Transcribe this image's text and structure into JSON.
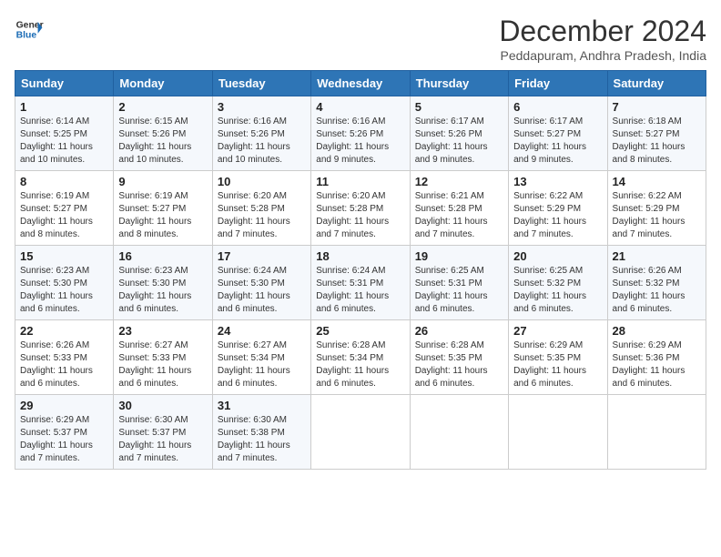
{
  "logo": {
    "line1": "General",
    "line2": "Blue"
  },
  "title": "December 2024",
  "subtitle": "Peddapuram, Andhra Pradesh, India",
  "days_of_week": [
    "Sunday",
    "Monday",
    "Tuesday",
    "Wednesday",
    "Thursday",
    "Friday",
    "Saturday"
  ],
  "weeks": [
    [
      {
        "day": "1",
        "info": "Sunrise: 6:14 AM\nSunset: 5:25 PM\nDaylight: 11 hours\nand 10 minutes."
      },
      {
        "day": "2",
        "info": "Sunrise: 6:15 AM\nSunset: 5:26 PM\nDaylight: 11 hours\nand 10 minutes."
      },
      {
        "day": "3",
        "info": "Sunrise: 6:16 AM\nSunset: 5:26 PM\nDaylight: 11 hours\nand 10 minutes."
      },
      {
        "day": "4",
        "info": "Sunrise: 6:16 AM\nSunset: 5:26 PM\nDaylight: 11 hours\nand 9 minutes."
      },
      {
        "day": "5",
        "info": "Sunrise: 6:17 AM\nSunset: 5:26 PM\nDaylight: 11 hours\nand 9 minutes."
      },
      {
        "day": "6",
        "info": "Sunrise: 6:17 AM\nSunset: 5:27 PM\nDaylight: 11 hours\nand 9 minutes."
      },
      {
        "day": "7",
        "info": "Sunrise: 6:18 AM\nSunset: 5:27 PM\nDaylight: 11 hours\nand 8 minutes."
      }
    ],
    [
      {
        "day": "8",
        "info": "Sunrise: 6:19 AM\nSunset: 5:27 PM\nDaylight: 11 hours\nand 8 minutes."
      },
      {
        "day": "9",
        "info": "Sunrise: 6:19 AM\nSunset: 5:27 PM\nDaylight: 11 hours\nand 8 minutes."
      },
      {
        "day": "10",
        "info": "Sunrise: 6:20 AM\nSunset: 5:28 PM\nDaylight: 11 hours\nand 7 minutes."
      },
      {
        "day": "11",
        "info": "Sunrise: 6:20 AM\nSunset: 5:28 PM\nDaylight: 11 hours\nand 7 minutes."
      },
      {
        "day": "12",
        "info": "Sunrise: 6:21 AM\nSunset: 5:28 PM\nDaylight: 11 hours\nand 7 minutes."
      },
      {
        "day": "13",
        "info": "Sunrise: 6:22 AM\nSunset: 5:29 PM\nDaylight: 11 hours\nand 7 minutes."
      },
      {
        "day": "14",
        "info": "Sunrise: 6:22 AM\nSunset: 5:29 PM\nDaylight: 11 hours\nand 7 minutes."
      }
    ],
    [
      {
        "day": "15",
        "info": "Sunrise: 6:23 AM\nSunset: 5:30 PM\nDaylight: 11 hours\nand 6 minutes."
      },
      {
        "day": "16",
        "info": "Sunrise: 6:23 AM\nSunset: 5:30 PM\nDaylight: 11 hours\nand 6 minutes."
      },
      {
        "day": "17",
        "info": "Sunrise: 6:24 AM\nSunset: 5:30 PM\nDaylight: 11 hours\nand 6 minutes."
      },
      {
        "day": "18",
        "info": "Sunrise: 6:24 AM\nSunset: 5:31 PM\nDaylight: 11 hours\nand 6 minutes."
      },
      {
        "day": "19",
        "info": "Sunrise: 6:25 AM\nSunset: 5:31 PM\nDaylight: 11 hours\nand 6 minutes."
      },
      {
        "day": "20",
        "info": "Sunrise: 6:25 AM\nSunset: 5:32 PM\nDaylight: 11 hours\nand 6 minutes."
      },
      {
        "day": "21",
        "info": "Sunrise: 6:26 AM\nSunset: 5:32 PM\nDaylight: 11 hours\nand 6 minutes."
      }
    ],
    [
      {
        "day": "22",
        "info": "Sunrise: 6:26 AM\nSunset: 5:33 PM\nDaylight: 11 hours\nand 6 minutes."
      },
      {
        "day": "23",
        "info": "Sunrise: 6:27 AM\nSunset: 5:33 PM\nDaylight: 11 hours\nand 6 minutes."
      },
      {
        "day": "24",
        "info": "Sunrise: 6:27 AM\nSunset: 5:34 PM\nDaylight: 11 hours\nand 6 minutes."
      },
      {
        "day": "25",
        "info": "Sunrise: 6:28 AM\nSunset: 5:34 PM\nDaylight: 11 hours\nand 6 minutes."
      },
      {
        "day": "26",
        "info": "Sunrise: 6:28 AM\nSunset: 5:35 PM\nDaylight: 11 hours\nand 6 minutes."
      },
      {
        "day": "27",
        "info": "Sunrise: 6:29 AM\nSunset: 5:35 PM\nDaylight: 11 hours\nand 6 minutes."
      },
      {
        "day": "28",
        "info": "Sunrise: 6:29 AM\nSunset: 5:36 PM\nDaylight: 11 hours\nand 6 minutes."
      }
    ],
    [
      {
        "day": "29",
        "info": "Sunrise: 6:29 AM\nSunset: 5:37 PM\nDaylight: 11 hours\nand 7 minutes."
      },
      {
        "day": "30",
        "info": "Sunrise: 6:30 AM\nSunset: 5:37 PM\nDaylight: 11 hours\nand 7 minutes."
      },
      {
        "day": "31",
        "info": "Sunrise: 6:30 AM\nSunset: 5:38 PM\nDaylight: 11 hours\nand 7 minutes."
      },
      {
        "day": "",
        "info": ""
      },
      {
        "day": "",
        "info": ""
      },
      {
        "day": "",
        "info": ""
      },
      {
        "day": "",
        "info": ""
      }
    ]
  ]
}
